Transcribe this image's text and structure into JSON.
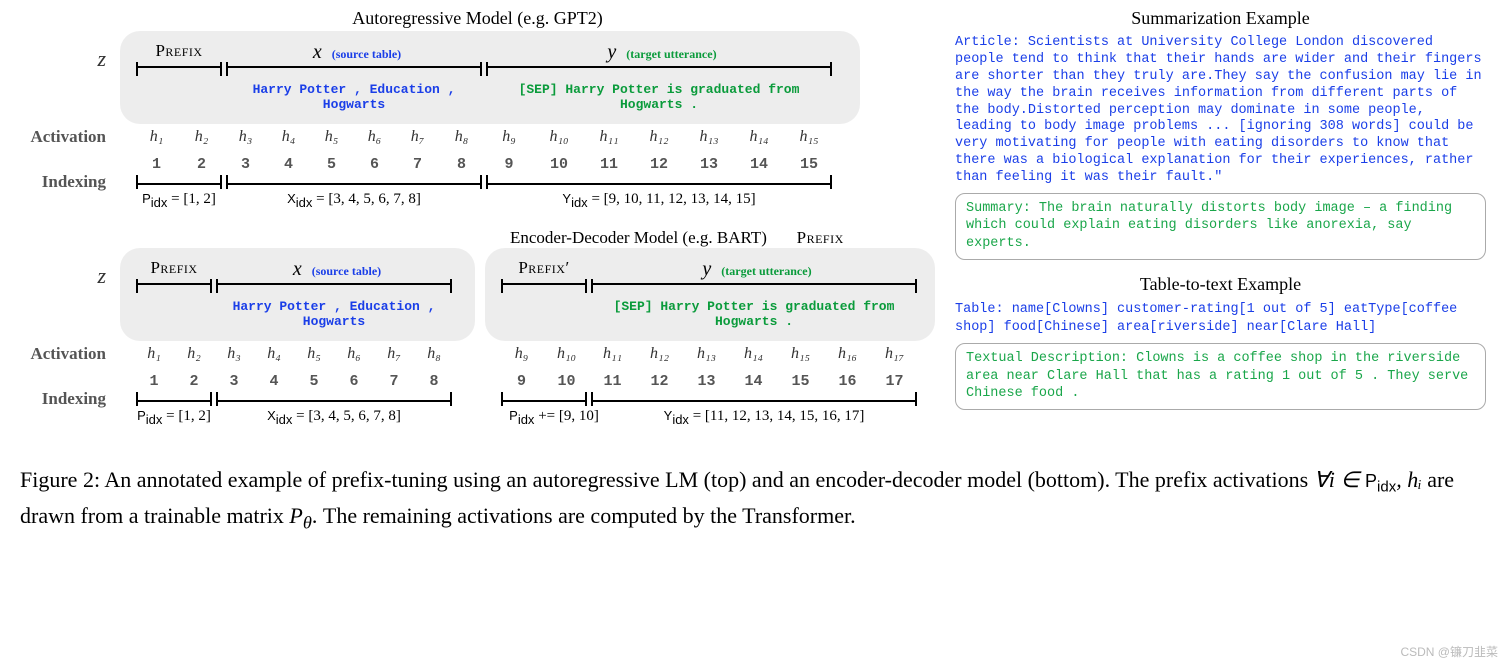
{
  "top": {
    "title": "Autoregressive Model (e.g. GPT2)",
    "prefix_label": "Prefix",
    "x_var": "x",
    "x_anno": "(source table)",
    "y_var": "y",
    "y_anno": "(target utterance)",
    "z_label": "z",
    "act_label": "Activation",
    "idx_label": "Indexing",
    "tokens_source": "Harry  Potter ,  Education ,  Hogwarts",
    "tokens_target": "[SEP]  Harry  Potter   is  graduated  from  Hogwarts .",
    "h": [
      "h₁",
      "h₂",
      "h₃",
      "h₄",
      "h₅",
      "h₆",
      "h₇",
      "h₈",
      "h₉",
      "h₁₀",
      "h₁₁",
      "h₁₂",
      "h₁₃",
      "h₁₄",
      "h₁₅"
    ],
    "idx": [
      "1",
      "2",
      "3",
      "4",
      "5",
      "6",
      "7",
      "8",
      "9",
      "10",
      "11",
      "12",
      "13",
      "14",
      "15"
    ],
    "p_idx": "Pidx = [1, 2]",
    "x_idx": "Xidx = [3, 4, 5, 6, 7, 8]",
    "y_idx": "Yidx = [9, 10, 11, 12, 13, 14, 15]"
  },
  "bottom": {
    "title": "Encoder-Decoder Model (e.g. BART)",
    "prefix2_label": "Prefix",
    "prefix_label": "Prefix",
    "prefix_prime": "Prefix′",
    "x_var": "x",
    "x_anno": "(source table)",
    "y_var": "y",
    "y_anno": "(target utterance)",
    "z_label": "z",
    "act_label": "Activation",
    "idx_label": "Indexing",
    "tokens_source": "Harry  Potter ,  Education ,  Hogwarts",
    "tokens_target": "[SEP]  Harry  Potter   is  graduated  from  Hogwarts .",
    "h_enc": [
      "h₁",
      "h₂",
      "h₃",
      "h₄",
      "h₅",
      "h₆",
      "h₇",
      "h₈"
    ],
    "h_dec": [
      "h₉",
      "h₁₀",
      "h₁₁",
      "h₁₂",
      "h₁₃",
      "h₁₄",
      "h₁₅",
      "h₁₆",
      "h₁₇"
    ],
    "idx_enc": [
      "1",
      "2",
      "3",
      "4",
      "5",
      "6",
      "7",
      "8"
    ],
    "idx_dec": [
      "9",
      "10",
      "11",
      "12",
      "13",
      "14",
      "15",
      "16",
      "17"
    ],
    "p_idx": "Pidx = [1, 2]",
    "x_idx": "Xidx = [3, 4, 5, 6, 7, 8]",
    "p2_idx": "Pidx += [9, 10]",
    "y_idx": "Yidx = [11, 12, 13, 14, 15, 16, 17]"
  },
  "summarization": {
    "title": "Summarization Example",
    "article": "Article: Scientists at University College London discovered people tend to think that their hands are wider and their fingers are shorter than they truly are.They say the confusion may lie in the way the brain receives information from different parts of the body.Distorted perception may dominate in some people, leading to body image problems ... [ignoring 308 words] could be very motivating for people with eating disorders to know that there was a biological explanation for their experiences, rather than feeling it was their fault.\"",
    "summary": "Summary: The brain naturally distorts body image – a finding which could explain eating disorders like anorexia, say experts."
  },
  "table_example": {
    "title": "Table-to-text Example",
    "table": "Table:  name[Clowns] customer-rating[1 out of 5]  eatType[coffee shop] food[Chinese] area[riverside] near[Clare Hall]",
    "desc": "Textual Description: Clowns is a coffee shop in the riverside area near Clare Hall that has a rating 1 out of 5 . They serve Chinese food ."
  },
  "caption": {
    "prefix": "Figure 2:  An annotated example of prefix-tuning using an autoregressive LM (top) and an encoder-decoder model (bottom). The prefix activations ",
    "math1": "∀i ∈ ",
    "pidx": "Pidx",
    "math2": ", hᵢ",
    "mid": " are drawn from a trainable matrix ",
    "ptheta": "P_θ",
    "suffix": ". The remaining activations are computed by the Transformer."
  },
  "watermark": "CSDN @镰刀韭菜"
}
